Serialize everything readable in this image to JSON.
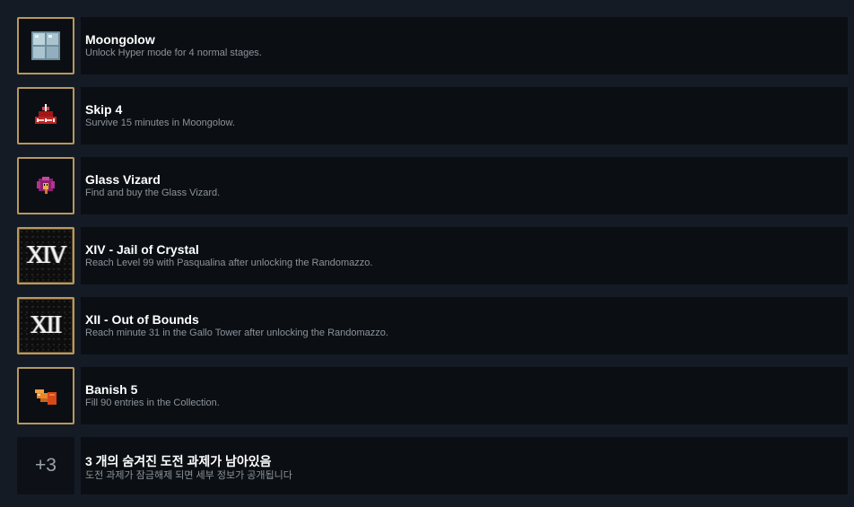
{
  "achievements": [
    {
      "icon": "window-icon",
      "title": "Moongolow",
      "description": "Unlock Hyper mode for 4 normal stages."
    },
    {
      "icon": "skip-icon",
      "title": "Skip 4",
      "description": "Survive 15 minutes in Moongolow."
    },
    {
      "icon": "glass-vizard-icon",
      "title": "Glass Vizard",
      "description": "Find and buy the Glass Vizard."
    },
    {
      "icon": "arcana-xiv-icon",
      "title": "XIV - Jail of Crystal",
      "description": "Reach Level 99 with Pasqualina after unlocking the Randomazzo.",
      "numeral": "XIV"
    },
    {
      "icon": "arcana-xii-icon",
      "title": "XII - Out of Bounds",
      "description": "Reach minute 31 in the Gallo Tower after unlocking the Randomazzo.",
      "numeral": "XII"
    },
    {
      "icon": "banish-icon",
      "title": "Banish 5",
      "description": "Fill 90 entries in the Collection."
    }
  ],
  "hidden": {
    "count_label": "+3",
    "title": "3 개의 숨겨진 도전 과제가 남아있음",
    "description": "도전 과제가 잠금해제 되면 세부 정보가 공개됩니다"
  },
  "colors": {
    "background": "#141b25",
    "panel": "#0b0f14",
    "icon_border": "#b9985c",
    "title": "#ffffff",
    "description": "#8c939b"
  }
}
